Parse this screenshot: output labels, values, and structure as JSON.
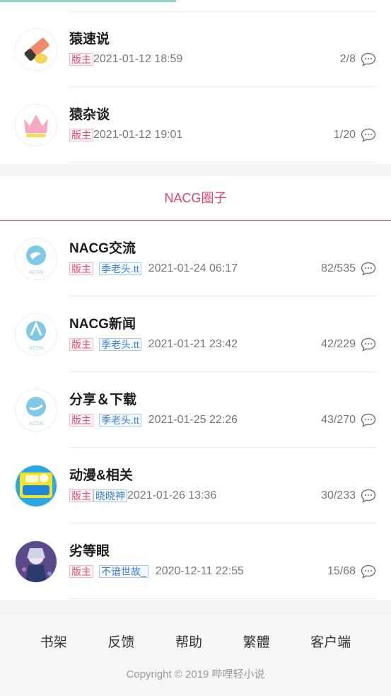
{
  "progress_fraction": 0.45,
  "group1": {
    "items": [
      {
        "title": "猿速说",
        "owner_tag": "版主",
        "mod": "",
        "time": "2021-01-12 18:59",
        "count": "2/8"
      },
      {
        "title": "猿杂谈",
        "owner_tag": "版主",
        "mod": "",
        "time": "2021-01-12 19:01",
        "count": "1/20"
      }
    ]
  },
  "section": {
    "title": "NACG圈子"
  },
  "group2": {
    "items": [
      {
        "title": "NACG交流",
        "owner_tag": "版主",
        "mod": "季老头.tt",
        "time": "2021-01-24 06:17",
        "count": "82/535"
      },
      {
        "title": "NACG新闻",
        "owner_tag": "版主",
        "mod": "季老头.tt",
        "time": "2021-01-21 23:42",
        "count": "42/229"
      },
      {
        "title": "分享＆下载",
        "owner_tag": "版主",
        "mod": "季老头.tt",
        "time": "2021-01-25 22:26",
        "count": "43/270"
      },
      {
        "title": "动漫&相关",
        "owner_tag": "版主",
        "mod": "晓晓神",
        "time": "2021-01-26 13:36",
        "count": "30/233"
      },
      {
        "title": "劣等眼",
        "owner_tag": "版主",
        "mod": "不谙世故_",
        "time": "2020-12-11 22:55",
        "count": "15/68"
      }
    ]
  },
  "footer": {
    "nav": [
      "书架",
      "反馈",
      "帮助",
      "繁體",
      "客户端"
    ],
    "copyright": "Copyright © 2019 哔哩轻小说"
  },
  "colors": {
    "accent": "#e0456a",
    "owner_tag": "#e34b6b",
    "mod_tag": "#3d7fd1",
    "progress": "#8fd3c6"
  }
}
